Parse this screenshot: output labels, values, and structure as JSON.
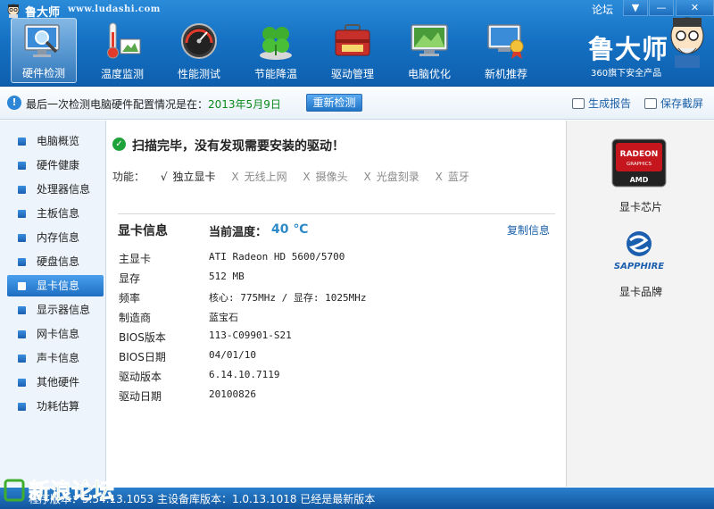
{
  "app": {
    "title": "鲁大师",
    "url": "www.ludashi.com",
    "forum": "论坛"
  },
  "window_controls": {
    "menu": "▼",
    "minimize": "—",
    "close": "✕"
  },
  "nav": [
    {
      "label": "硬件检测",
      "icon": "monitor-magnifier-icon",
      "active": true
    },
    {
      "label": "温度监测",
      "icon": "thermometer-icon",
      "active": false
    },
    {
      "label": "性能测试",
      "icon": "speedometer-icon",
      "active": false
    },
    {
      "label": "节能降温",
      "icon": "clover-icon",
      "active": false
    },
    {
      "label": "驱动管理",
      "icon": "toolbox-icon",
      "active": false
    },
    {
      "label": "电脑优化",
      "icon": "optimize-monitor-icon",
      "active": false
    },
    {
      "label": "新机推荐",
      "icon": "new-pc-award-icon",
      "active": false
    }
  ],
  "brand": {
    "name": "鲁大师",
    "subtitle": "360旗下安全产品"
  },
  "infobar": {
    "prefix": "最后一次检测电脑硬件配置情况是在：",
    "date": "2013年5月9日",
    "recheck": "重新检测",
    "report": "生成报告",
    "screenshot": "保存截屏"
  },
  "sidebar": {
    "items": [
      {
        "label": "电脑概览",
        "active": false
      },
      {
        "label": "硬件健康",
        "active": false
      },
      {
        "label": "处理器信息",
        "active": false
      },
      {
        "label": "主板信息",
        "active": false
      },
      {
        "label": "内存信息",
        "active": false
      },
      {
        "label": "硬盘信息",
        "active": false
      },
      {
        "label": "显卡信息",
        "active": true
      },
      {
        "label": "显示器信息",
        "active": false
      },
      {
        "label": "网卡信息",
        "active": false
      },
      {
        "label": "声卡信息",
        "active": false
      },
      {
        "label": "其他硬件",
        "active": false
      },
      {
        "label": "功耗估算",
        "active": false
      }
    ]
  },
  "main": {
    "scan_result": "扫描完毕，没有发现需要安装的驱动！",
    "features_label": "功能：",
    "features": [
      {
        "mark": "√",
        "label": "独立显卡",
        "enabled": true
      },
      {
        "mark": "X",
        "label": "无线上网",
        "enabled": false
      },
      {
        "mark": "X",
        "label": "摄像头",
        "enabled": false
      },
      {
        "mark": "X",
        "label": "光盘刻录",
        "enabled": false
      },
      {
        "mark": "X",
        "label": "蓝牙",
        "enabled": false
      }
    ],
    "gpu_title": "显卡信息",
    "temp_label": "当前温度：",
    "temp_value": "40 ℃",
    "copy_info": "复制信息",
    "rows": [
      {
        "key": "主显卡",
        "value": "ATI Radeon HD 5600/5700"
      },
      {
        "key": "显存",
        "value": "512 MB"
      },
      {
        "key": "频率",
        "value": "核心: 775MHz / 显存: 1025MHz"
      },
      {
        "key": "制造商",
        "value": "蓝宝石"
      },
      {
        "key": "BIOS版本",
        "value": "113-C09901-S21"
      },
      {
        "key": "BIOS日期",
        "value": "04/01/10"
      },
      {
        "key": "驱动版本",
        "value": "6.14.10.7119"
      },
      {
        "key": "驱动日期",
        "value": "20100826"
      }
    ]
  },
  "right_panel": {
    "chip_logo": {
      "line1": "RADEON",
      "line2": "GRAPHICS",
      "line3": "AMD"
    },
    "chip_label": "显卡芯片",
    "brand_logo": "SAPPHIRE",
    "brand_label": "显卡品牌"
  },
  "statusbar": {
    "text": "程序版本：5.54.13.1053  主设备库版本：1.0.13.1018  已经是最新版本"
  },
  "watermark": {
    "text": "新浪论坛"
  },
  "colors": {
    "accent": "#1672c4",
    "date_green": "#0a8a1d",
    "temp_blue": "#2e89c7",
    "link": "#1a5fa8"
  }
}
